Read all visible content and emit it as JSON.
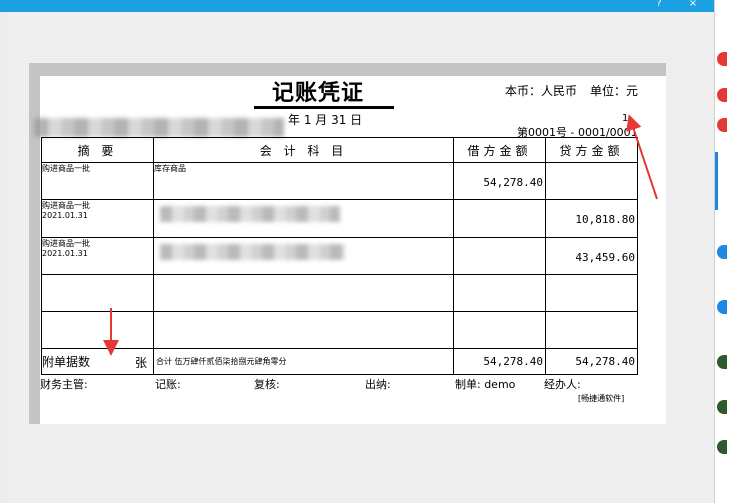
{
  "window": {
    "buttons": [
      "?",
      "×"
    ]
  },
  "voucher": {
    "title": "记账凭证",
    "currency": "本币：人民币",
    "unit": "单位：元",
    "date": "年  1  月 31 日",
    "page": "1",
    "number": "第0001号 - 0001/0001",
    "headers": {
      "summary": "摘 要",
      "account": "会 计 科 目",
      "debit": "借方金额",
      "credit": "贷方金额"
    },
    "rows": [
      {
        "summary": "购进商品一批",
        "account": "库存商品",
        "debit": "54,278.40",
        "credit": ""
      },
      {
        "summary": "购进商品一批\n2021.01.31",
        "account": "",
        "debit": "",
        "credit": "10,818.80"
      },
      {
        "summary": "购进商品一批\n2021.01.31",
        "account": "",
        "debit": "",
        "credit": "43,459.60"
      }
    ],
    "attachments": "附单据数",
    "attachments_unit": "张",
    "total_label": "合计 伍万肆仟贰佰柒拾捌元肆角零分",
    "total_debit": "54,278.40",
    "total_credit": "54,278.40",
    "signers": {
      "chief": "财务主管:",
      "bookkeeper": "记账:",
      "reviewer": "复核:",
      "cashier": "出纳:",
      "maker": "制单: demo",
      "handler": "经办人:"
    },
    "brand": "[畅捷通软件]"
  },
  "colors": {
    "titlebar": "#1ba1e2",
    "arrow": "#e53935"
  }
}
